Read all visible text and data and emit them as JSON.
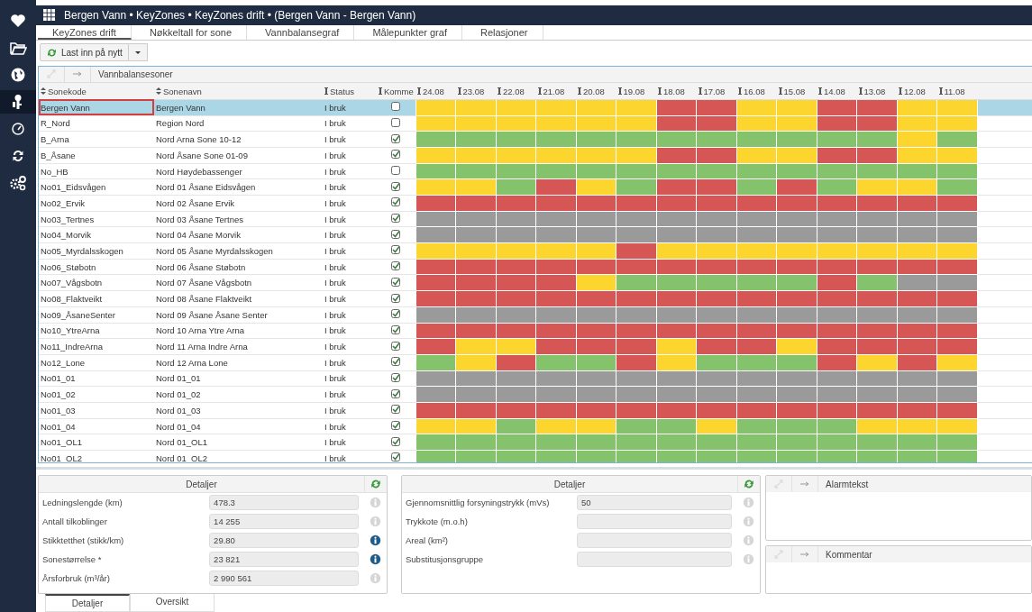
{
  "window": {
    "title": "Bergen Vann • KeyZones • KeyZones drift • (Bergen Vann - Bergen Vann)"
  },
  "sidebar": {
    "items": [
      {
        "selected": false
      },
      {
        "selected": false
      },
      {
        "selected": false
      },
      {
        "selected": true
      },
      {
        "selected": false
      },
      {
        "selected": false
      },
      {
        "selected": false
      }
    ]
  },
  "tabs": [
    {
      "label": "KeyZones drift",
      "selected": true
    },
    {
      "label": "Nøkkeltall for sone",
      "selected": false
    },
    {
      "label": "Vannbalansegraf",
      "selected": false
    },
    {
      "label": "Målepunkter graf",
      "selected": false
    },
    {
      "label": "Relasjoner",
      "selected": false
    }
  ],
  "toolbar": {
    "reload_button": "Last inn på nytt"
  },
  "grid": {
    "title": "Vannbalansesoner",
    "columns": [
      "Sonekode",
      "Sonenavn",
      "Status",
      "Komme"
    ],
    "dates": [
      "24.08",
      "23.08",
      "22.08",
      "21.08",
      "20.08",
      "19.08",
      "18.08",
      "17.08",
      "16.08",
      "15.08",
      "14.08",
      "13.08",
      "12.08",
      "11.08"
    ],
    "rows": [
      {
        "code": "Bergen Vann",
        "name": "Bergen Vann",
        "status": "I bruk",
        "komme": false,
        "selected": true,
        "cells": [
          {
            "color": "#fcd62e"
          },
          {
            "color": "#fcd62e"
          },
          {
            "color": "#fcd62e"
          },
          {
            "color": "#fcd62e"
          },
          {
            "color": "#fcd62e"
          },
          {
            "color": "#fcd62e"
          },
          {
            "color": "#d65656"
          },
          {
            "color": "#d65656"
          },
          {
            "color": "#fcd62e"
          },
          {
            "color": "#fcd62e"
          },
          {
            "color": "#d65656"
          },
          {
            "color": "#d65656"
          },
          {
            "color": "#fcd62e"
          },
          {
            "color": "#fcd62e"
          }
        ]
      },
      {
        "code": "R_Nord",
        "name": "Region Nord",
        "status": "I bruk",
        "komme": false,
        "selected": false,
        "cells": [
          {
            "color": "#fcd62e"
          },
          {
            "color": "#fcd62e"
          },
          {
            "color": "#fcd62e"
          },
          {
            "color": "#fcd62e"
          },
          {
            "color": "#fcd62e"
          },
          {
            "color": "#fcd62e"
          },
          {
            "color": "#d65656"
          },
          {
            "color": "#d65656"
          },
          {
            "color": "#fcd62e"
          },
          {
            "color": "#fcd62e"
          },
          {
            "color": "#d65656"
          },
          {
            "color": "#d65656"
          },
          {
            "color": "#fcd62e"
          },
          {
            "color": "#fcd62e"
          }
        ]
      },
      {
        "code": "B_Arna",
        "name": "Nord Arna Sone 10-12",
        "status": "I bruk",
        "komme": true,
        "selected": false,
        "cells": [
          {
            "color": "#84c36b"
          },
          {
            "color": "#84c36b"
          },
          {
            "color": "#84c36b"
          },
          {
            "color": "#84c36b"
          },
          {
            "color": "#84c36b"
          },
          {
            "color": "#84c36b"
          },
          {
            "color": "#84c36b"
          },
          {
            "color": "#84c36b"
          },
          {
            "color": "#84c36b"
          },
          {
            "color": "#84c36b"
          },
          {
            "color": "#84c36b"
          },
          {
            "color": "#84c36b"
          },
          {
            "color": "#fcd62e"
          },
          {
            "color": "#84c36b"
          }
        ]
      },
      {
        "code": "B_Åsane",
        "name": "Nord Åsane Sone 01-09",
        "status": "I bruk",
        "komme": true,
        "selected": false,
        "cells": [
          {
            "color": "#fcd62e"
          },
          {
            "color": "#fcd62e"
          },
          {
            "color": "#fcd62e"
          },
          {
            "color": "#fcd62e"
          },
          {
            "color": "#fcd62e"
          },
          {
            "color": "#fcd62e"
          },
          {
            "color": "#d65656"
          },
          {
            "color": "#d65656"
          },
          {
            "color": "#fcd62e"
          },
          {
            "color": "#fcd62e"
          },
          {
            "color": "#d65656"
          },
          {
            "color": "#d65656"
          },
          {
            "color": "#fcd62e"
          },
          {
            "color": "#fcd62e"
          }
        ]
      },
      {
        "code": "No_HB",
        "name": "Nord Høydebassenger",
        "status": "I bruk",
        "komme": false,
        "selected": false,
        "cells": [
          {
            "color": "#84c36b"
          },
          {
            "color": "#84c36b"
          },
          {
            "color": "#84c36b"
          },
          {
            "color": "#84c36b"
          },
          {
            "color": "#84c36b"
          },
          {
            "color": "#84c36b"
          },
          {
            "color": "#84c36b"
          },
          {
            "color": "#84c36b"
          },
          {
            "color": "#84c36b"
          },
          {
            "color": "#84c36b"
          },
          {
            "color": "#84c36b"
          },
          {
            "color": "#84c36b"
          },
          {
            "color": "#84c36b"
          },
          {
            "color": "#84c36b"
          }
        ]
      },
      {
        "code": "No01_Eidsvågen",
        "name": "Nord 01 Åsane Eidsvågen",
        "status": "I bruk",
        "komme": true,
        "selected": false,
        "cells": [
          {
            "color": "#fcd62e"
          },
          {
            "color": "#fcd62e"
          },
          {
            "color": "#84c36b"
          },
          {
            "color": "#d65656"
          },
          {
            "color": "#fcd62e"
          },
          {
            "color": "#84c36b"
          },
          {
            "color": "#d65656"
          },
          {
            "color": "#d65656"
          },
          {
            "color": "#84c36b"
          },
          {
            "color": "#d65656"
          },
          {
            "color": "#84c36b"
          },
          {
            "color": "#fcd62e"
          },
          {
            "color": "#fcd62e"
          },
          {
            "color": "#84c36b"
          }
        ]
      },
      {
        "code": "No02_Ervik",
        "name": "Nord 02 Åsane Ervik",
        "status": "I bruk",
        "komme": true,
        "selected": false,
        "cells": [
          {
            "color": "#d65656"
          },
          {
            "color": "#d65656"
          },
          {
            "color": "#d65656"
          },
          {
            "color": "#d65656"
          },
          {
            "color": "#d65656"
          },
          {
            "color": "#d65656"
          },
          {
            "color": "#d65656"
          },
          {
            "color": "#d65656"
          },
          {
            "color": "#d65656"
          },
          {
            "color": "#d65656"
          },
          {
            "color": "#d65656"
          },
          {
            "color": "#d65656"
          },
          {
            "color": "#d65656"
          },
          {
            "color": "#d65656"
          }
        ]
      },
      {
        "code": "No03_Tertnes",
        "name": "Nord 03 Åsane Tertnes",
        "status": "I bruk",
        "komme": true,
        "selected": false,
        "cells": [
          {
            "color": "#9a9a9a"
          },
          {
            "color": "#9a9a9a"
          },
          {
            "color": "#9a9a9a"
          },
          {
            "color": "#9a9a9a"
          },
          {
            "color": "#9a9a9a"
          },
          {
            "color": "#9a9a9a"
          },
          {
            "color": "#9a9a9a"
          },
          {
            "color": "#9a9a9a"
          },
          {
            "color": "#9a9a9a"
          },
          {
            "color": "#9a9a9a"
          },
          {
            "color": "#9a9a9a"
          },
          {
            "color": "#9a9a9a"
          },
          {
            "color": "#9a9a9a"
          },
          {
            "color": "#9a9a9a"
          }
        ]
      },
      {
        "code": "No04_Morvik",
        "name": "Nord 04 Åsane Morvik",
        "status": "I bruk",
        "komme": true,
        "selected": false,
        "cells": [
          {
            "color": "#9a9a9a"
          },
          {
            "color": "#9a9a9a"
          },
          {
            "color": "#9a9a9a"
          },
          {
            "color": "#9a9a9a"
          },
          {
            "color": "#9a9a9a"
          },
          {
            "color": "#9a9a9a"
          },
          {
            "color": "#9a9a9a"
          },
          {
            "color": "#9a9a9a"
          },
          {
            "color": "#9a9a9a"
          },
          {
            "color": "#9a9a9a"
          },
          {
            "color": "#9a9a9a"
          },
          {
            "color": "#9a9a9a"
          },
          {
            "color": "#9a9a9a"
          },
          {
            "color": "#9a9a9a"
          }
        ]
      },
      {
        "code": "No05_Myrdalsskogen",
        "name": "Nord 05 Åsane Myrdalsskogen",
        "status": "I bruk",
        "komme": true,
        "selected": false,
        "cells": [
          {
            "color": "#fcd62e"
          },
          {
            "color": "#fcd62e"
          },
          {
            "color": "#fcd62e"
          },
          {
            "color": "#fcd62e"
          },
          {
            "color": "#fcd62e"
          },
          {
            "color": "#d65656"
          },
          {
            "color": "#fcd62e"
          },
          {
            "color": "#fcd62e"
          },
          {
            "color": "#fcd62e"
          },
          {
            "color": "#fcd62e"
          },
          {
            "color": "#fcd62e"
          },
          {
            "color": "#fcd62e"
          },
          {
            "color": "#fcd62e"
          },
          {
            "color": "#fcd62e"
          }
        ]
      },
      {
        "code": "No06_Støbotn",
        "name": "Nord 06 Åsane Støbotn",
        "status": "I bruk",
        "komme": true,
        "selected": false,
        "cells": [
          {
            "color": "#d65656"
          },
          {
            "color": "#d65656"
          },
          {
            "color": "#d65656"
          },
          {
            "color": "#d65656"
          },
          {
            "color": "#d65656"
          },
          {
            "color": "#d65656"
          },
          {
            "color": "#d65656"
          },
          {
            "color": "#d65656"
          },
          {
            "color": "#d65656"
          },
          {
            "color": "#d65656"
          },
          {
            "color": "#d65656"
          },
          {
            "color": "#d65656"
          },
          {
            "color": "#d65656"
          },
          {
            "color": "#d65656"
          }
        ]
      },
      {
        "code": "No07_Vågsbotn",
        "name": "Nord 07 Åsane Vågsbotn",
        "status": "I bruk",
        "komme": true,
        "selected": false,
        "cells": [
          {
            "color": "#d65656"
          },
          {
            "color": "#d65656"
          },
          {
            "color": "#d65656"
          },
          {
            "color": "#d65656"
          },
          {
            "color": "#fcd62e"
          },
          {
            "color": "#84c36b"
          },
          {
            "color": "#84c36b"
          },
          {
            "color": "#84c36b"
          },
          {
            "color": "#84c36b"
          },
          {
            "color": "#84c36b"
          },
          {
            "color": "#d65656"
          },
          {
            "color": "#84c36b"
          },
          {
            "color": "#9a9a9a"
          },
          {
            "color": "#9a9a9a"
          }
        ]
      },
      {
        "code": "No08_Flaktveikt",
        "name": "Nord 08 Åsane Flaktveikt",
        "status": "I bruk",
        "komme": true,
        "selected": false,
        "cells": [
          {
            "color": "#d65656"
          },
          {
            "color": "#d65656"
          },
          {
            "color": "#d65656"
          },
          {
            "color": "#d65656"
          },
          {
            "color": "#d65656"
          },
          {
            "color": "#d65656"
          },
          {
            "color": "#d65656"
          },
          {
            "color": "#d65656"
          },
          {
            "color": "#d65656"
          },
          {
            "color": "#d65656"
          },
          {
            "color": "#d65656"
          },
          {
            "color": "#d65656"
          },
          {
            "color": "#d65656"
          },
          {
            "color": "#d65656"
          }
        ]
      },
      {
        "code": "No09_ÅsaneSenter",
        "name": "Nord 09 Åsane Åsane Senter",
        "status": "I bruk",
        "komme": true,
        "selected": false,
        "cells": [
          {
            "color": "#9a9a9a"
          },
          {
            "color": "#9a9a9a"
          },
          {
            "color": "#9a9a9a"
          },
          {
            "color": "#9a9a9a"
          },
          {
            "color": "#9a9a9a"
          },
          {
            "color": "#9a9a9a"
          },
          {
            "color": "#9a9a9a"
          },
          {
            "color": "#9a9a9a"
          },
          {
            "color": "#9a9a9a"
          },
          {
            "color": "#9a9a9a"
          },
          {
            "color": "#9a9a9a"
          },
          {
            "color": "#9a9a9a"
          },
          {
            "color": "#9a9a9a"
          },
          {
            "color": "#9a9a9a"
          }
        ]
      },
      {
        "code": "No10_YtreArna",
        "name": "Nord 10 Arna Ytre Arna",
        "status": "I bruk",
        "komme": true,
        "selected": false,
        "cells": [
          {
            "color": "#d65656"
          },
          {
            "color": "#d65656"
          },
          {
            "color": "#d65656"
          },
          {
            "color": "#d65656"
          },
          {
            "color": "#d65656"
          },
          {
            "color": "#d65656"
          },
          {
            "color": "#d65656"
          },
          {
            "color": "#d65656"
          },
          {
            "color": "#d65656"
          },
          {
            "color": "#d65656"
          },
          {
            "color": "#d65656"
          },
          {
            "color": "#d65656"
          },
          {
            "color": "#d65656"
          },
          {
            "color": "#d65656"
          }
        ]
      },
      {
        "code": "No11_IndreArna",
        "name": "Nord 11 Arna Indre Arna",
        "status": "I bruk",
        "komme": true,
        "selected": false,
        "cells": [
          {
            "color": "#d65656"
          },
          {
            "color": "#fcd62e"
          },
          {
            "color": "#fcd62e"
          },
          {
            "color": "#d65656"
          },
          {
            "color": "#d65656"
          },
          {
            "color": "#d65656"
          },
          {
            "color": "#fcd62e"
          },
          {
            "color": "#d65656"
          },
          {
            "color": "#d65656"
          },
          {
            "color": "#fcd62e"
          },
          {
            "color": "#d65656"
          },
          {
            "color": "#d65656"
          },
          {
            "color": "#d65656"
          },
          {
            "color": "#d65656"
          }
        ]
      },
      {
        "code": "No12_Lone",
        "name": "Nord 12 Arna Lone",
        "status": "I bruk",
        "komme": true,
        "selected": false,
        "cells": [
          {
            "color": "#84c36b"
          },
          {
            "color": "#fcd62e"
          },
          {
            "color": "#d65656"
          },
          {
            "color": "#84c36b"
          },
          {
            "color": "#84c36b"
          },
          {
            "color": "#d65656"
          },
          {
            "color": "#fcd62e"
          },
          {
            "color": "#84c36b"
          },
          {
            "color": "#84c36b"
          },
          {
            "color": "#84c36b"
          },
          {
            "color": "#d65656"
          },
          {
            "color": "#fcd62e"
          },
          {
            "color": "#d65656"
          },
          {
            "color": "#fcd62e"
          }
        ]
      },
      {
        "code": "No01_01",
        "name": "Nord 01_01",
        "status": "I bruk",
        "komme": true,
        "selected": false,
        "cells": [
          {
            "color": "#9a9a9a"
          },
          {
            "color": "#9a9a9a"
          },
          {
            "color": "#9a9a9a"
          },
          {
            "color": "#9a9a9a"
          },
          {
            "color": "#9a9a9a"
          },
          {
            "color": "#9a9a9a"
          },
          {
            "color": "#9a9a9a"
          },
          {
            "color": "#9a9a9a"
          },
          {
            "color": "#9a9a9a"
          },
          {
            "color": "#9a9a9a"
          },
          {
            "color": "#9a9a9a"
          },
          {
            "color": "#9a9a9a"
          },
          {
            "color": "#9a9a9a"
          },
          {
            "color": "#9a9a9a"
          }
        ]
      },
      {
        "code": "No01_02",
        "name": "Nord 01_02",
        "status": "I bruk",
        "komme": true,
        "selected": false,
        "cells": [
          {
            "color": "#9a9a9a"
          },
          {
            "color": "#9a9a9a"
          },
          {
            "color": "#9a9a9a"
          },
          {
            "color": "#9a9a9a"
          },
          {
            "color": "#9a9a9a"
          },
          {
            "color": "#9a9a9a"
          },
          {
            "color": "#9a9a9a"
          },
          {
            "color": "#9a9a9a"
          },
          {
            "color": "#9a9a9a"
          },
          {
            "color": "#9a9a9a"
          },
          {
            "color": "#9a9a9a"
          },
          {
            "color": "#9a9a9a"
          },
          {
            "color": "#9a9a9a"
          },
          {
            "color": "#9a9a9a"
          }
        ]
      },
      {
        "code": "No01_03",
        "name": "Nord 01_03",
        "status": "I bruk",
        "komme": true,
        "selected": false,
        "cells": [
          {
            "color": "#d65656"
          },
          {
            "color": "#d65656"
          },
          {
            "color": "#d65656"
          },
          {
            "color": "#d65656"
          },
          {
            "color": "#d65656"
          },
          {
            "color": "#d65656"
          },
          {
            "color": "#d65656"
          },
          {
            "color": "#d65656"
          },
          {
            "color": "#d65656"
          },
          {
            "color": "#d65656"
          },
          {
            "color": "#d65656"
          },
          {
            "color": "#d65656"
          },
          {
            "color": "#d65656"
          },
          {
            "color": "#d65656"
          }
        ]
      },
      {
        "code": "No01_04",
        "name": "Nord 01_04",
        "status": "I bruk",
        "komme": true,
        "selected": false,
        "cells": [
          {
            "color": "#fcd62e"
          },
          {
            "color": "#fcd62e"
          },
          {
            "color": "#84c36b"
          },
          {
            "color": "#fcd62e"
          },
          {
            "color": "#fcd62e"
          },
          {
            "color": "#84c36b"
          },
          {
            "color": "#84c36b"
          },
          {
            "color": "#fcd62e"
          },
          {
            "color": "#84c36b"
          },
          {
            "color": "#84c36b"
          },
          {
            "color": "#84c36b"
          },
          {
            "color": "#fcd62e"
          },
          {
            "color": "#fcd62e"
          },
          {
            "color": "#fcd62e"
          }
        ]
      },
      {
        "code": "No01_OL1",
        "name": "Nord 01_OL1",
        "status": "I bruk",
        "komme": true,
        "selected": false,
        "cells": [
          {
            "color": "#84c36b"
          },
          {
            "color": "#84c36b"
          },
          {
            "color": "#84c36b"
          },
          {
            "color": "#84c36b"
          },
          {
            "color": "#84c36b"
          },
          {
            "color": "#84c36b"
          },
          {
            "color": "#84c36b"
          },
          {
            "color": "#84c36b"
          },
          {
            "color": "#84c36b"
          },
          {
            "color": "#84c36b"
          },
          {
            "color": "#84c36b"
          },
          {
            "color": "#84c36b"
          },
          {
            "color": "#84c36b"
          },
          {
            "color": "#84c36b"
          }
        ]
      },
      {
        "code": "No01_OL2",
        "name": "Nord 01_OL2",
        "status": "I bruk",
        "komme": true,
        "selected": false,
        "cells": [
          {
            "color": "#84c36b"
          },
          {
            "color": "#84c36b"
          },
          {
            "color": "#84c36b"
          },
          {
            "color": "#84c36b"
          },
          {
            "color": "#84c36b"
          },
          {
            "color": "#84c36b"
          },
          {
            "color": "#84c36b"
          },
          {
            "color": "#84c36b"
          },
          {
            "color": "#84c36b"
          },
          {
            "color": "#84c36b"
          },
          {
            "color": "#84c36b"
          },
          {
            "color": "#84c36b"
          },
          {
            "color": "#84c36b"
          },
          {
            "color": "#84c36b"
          }
        ]
      }
    ]
  },
  "details_left": {
    "title": "Detaljer",
    "fields": [
      {
        "label": "Ledningslengde (km)",
        "value": "478.3",
        "info_active": false
      },
      {
        "label": "Antall tilkoblinger",
        "value": "14 255",
        "info_active": false
      },
      {
        "label": "Stikktetthet (stikk/km)",
        "value": "29.80",
        "info_active": true
      },
      {
        "label": "Sonestørrelse *",
        "value": "23 821",
        "info_active": true
      },
      {
        "label": "Årsforbruk (m³/år)",
        "value": "2 990 561",
        "info_active": false
      }
    ]
  },
  "details_right": {
    "title": "Detaljer",
    "fields": [
      {
        "label": "Gjennomsnittlig forsyningstrykk (mVs)",
        "value": "50",
        "info_active": false
      },
      {
        "label": "Trykkote (m.o.h)",
        "info_active": false
      },
      {
        "label": "Areal (km²)",
        "info_active": false
      },
      {
        "label": "Substitusjonsgruppe",
        "info_active": false
      }
    ]
  },
  "alarm_panel": {
    "title": "Alarmtekst"
  },
  "comment_panel": {
    "title": "Kommentar"
  },
  "bottom_tabs": [
    {
      "label": "Detaljer",
      "selected": true
    },
    {
      "label": "Oversikt",
      "selected": false
    }
  ]
}
